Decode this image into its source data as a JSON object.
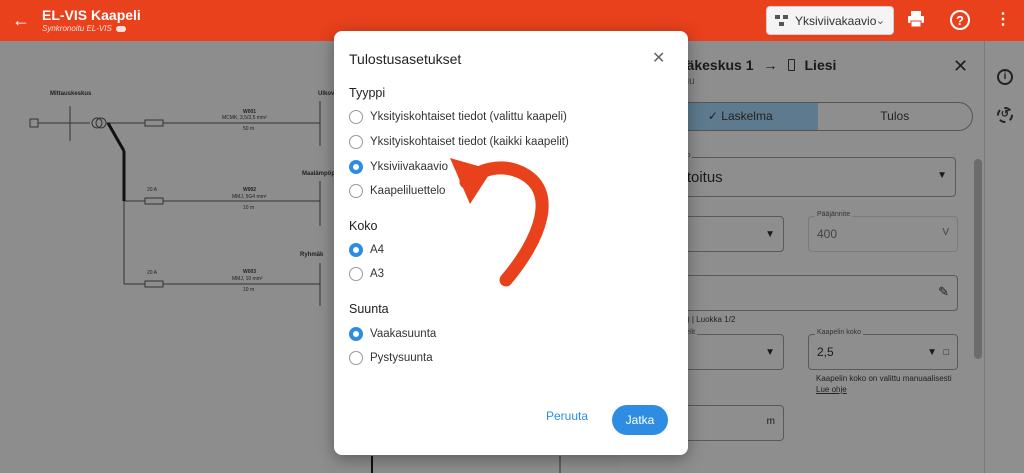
{
  "app": {
    "title": "EL-VIS Kaapeli",
    "subtitle": "Synkronoitu EL-VIS",
    "view_select": "Yksiviivakaavio"
  },
  "diagram": {
    "labels": [
      "Mittauskeskus",
      "Ulkov",
      "Maalämpöp",
      "Ryhmäk"
    ],
    "cables": [
      {
        "id": "W001",
        "spec": "MCMK, 3,5/3,5 mm²",
        "length": "50 m"
      },
      {
        "id": "W002",
        "spec": "MMJ, 5G4 mm²",
        "length": "10 m"
      },
      {
        "id": "W003",
        "spec": "MMJ, 10 mm²",
        "length": "10 m"
      }
    ],
    "fuses": [
      "20 A",
      "20 A"
    ]
  },
  "panel": {
    "title_from": "näkeskus 1",
    "title_to": "Liesi",
    "subtitle": "ttuu",
    "tabs": [
      "Laskelma",
      "Tulos"
    ],
    "field_mode_label": "toehto",
    "field_mode_value": "mitoitus",
    "field_voltage_label": "Pääjännite",
    "field_voltage_value": "400",
    "field_voltage_unit": "V",
    "field_install_label": "pi",
    "install_note": "°C) | Luokka 1/2",
    "field_cables_label": "kaapelit",
    "field_size_label": "Kaapelin koko",
    "field_size_value": "2,5",
    "size_note": "Kaapelin koko on valittu manuaalisesti",
    "size_link": "Lue ohje",
    "field_length_label": "us",
    "field_length_unit": "m"
  },
  "dialog": {
    "title": "Tulostusasetukset",
    "type_heading": "Tyyppi",
    "type_options": [
      "Yksityiskohtaiset tiedot (valittu kaapeli)",
      "Yksityiskohtaiset tiedot (kaikki kaapelit)",
      "Yksiviivakaavio",
      "Kaapeliluettelo"
    ],
    "size_heading": "Koko",
    "size_options": [
      "A4",
      "A3"
    ],
    "orientation_heading": "Suunta",
    "orientation_options": [
      "Vaakasuunta",
      "Pystysuunta"
    ],
    "cancel_label": "Peruuta",
    "continue_label": "Jatka",
    "selected": {
      "type": "Yksiviivakaavio",
      "size": "A4",
      "orientation": "Vaakasuunta"
    }
  },
  "colors": {
    "brand": "#e8411c",
    "accent": "#2e8de2",
    "annotation_arrow": "#e8411c"
  }
}
